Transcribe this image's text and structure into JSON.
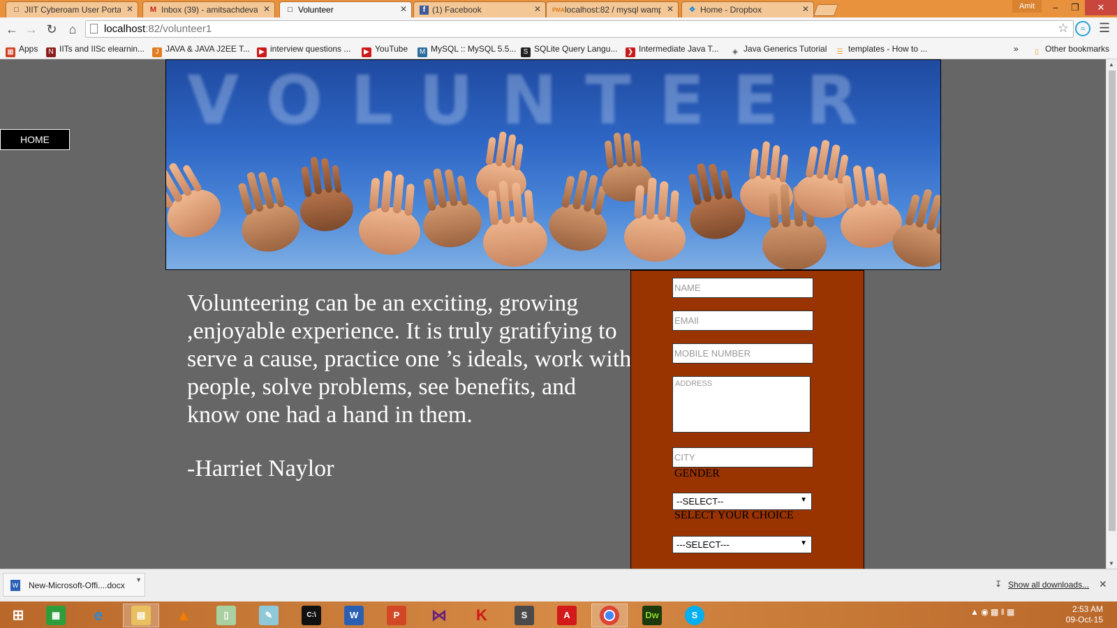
{
  "tabs": [
    {
      "title": "JIIT Cyberoam User Portal",
      "icon": "page-icon"
    },
    {
      "title": "Inbox (39) - amitsachdeva",
      "icon": "gmail-icon"
    },
    {
      "title": "Volunteer",
      "icon": "page-icon"
    },
    {
      "title": "(1) Facebook",
      "icon": "facebook-icon"
    },
    {
      "title": "localhost:82 / mysql wamp",
      "icon": "phpmyadmin-icon"
    },
    {
      "title": "Home - Dropbox",
      "icon": "dropbox-icon"
    }
  ],
  "window": {
    "user": "Amit"
  },
  "address_bar": {
    "host": "localhost",
    "path": ":82/volunteer1"
  },
  "bookmarks": [
    {
      "label": "Apps",
      "icon": "apps-grid-icon",
      "color": "#d04020"
    },
    {
      "label": "IITs and IISc elearnin...",
      "icon": "nptel-icon",
      "color": "#8a1f1f"
    },
    {
      "label": "JAVA & JAVA J2EE T...",
      "icon": "java-icon",
      "color": "#e07b20"
    },
    {
      "label": "interview questions ...",
      "icon": "youtube-icon",
      "color": "#cc1b1b"
    },
    {
      "label": "YouTube",
      "icon": "youtube-icon",
      "color": "#cc1b1b"
    },
    {
      "label": "MySQL :: MySQL 5.5...",
      "icon": "mysql-icon",
      "color": "#2c6e9b"
    },
    {
      "label": "SQLite Query Langu...",
      "icon": "sqlite-icon",
      "color": "#222222"
    },
    {
      "label": "Intermediate Java T...",
      "icon": "arrow-icon",
      "color": "#c81c1c"
    },
    {
      "label": "Java Generics Tutorial",
      "icon": "diamond-icon",
      "color": "#555555"
    },
    {
      "label": "templates - How to ...",
      "icon": "stack-icon",
      "color": "#f0a030"
    }
  ],
  "bookmarks_overflow": "»",
  "other_bookmarks": "Other bookmarks",
  "page": {
    "home_button": "HOME",
    "banner_word": "VOLUNTEER",
    "quote": "Volunteering can be an exciting, growing ,enjoyable experience. It is truly gratifying to serve a cause, practice one ’s ideals, work with people, solve problems, see benefits, and know one had a hand in them.",
    "author": "-Harriet Naylor"
  },
  "form": {
    "name_placeholder": "NAME",
    "email_placeholder": "EMAIl",
    "mobile_placeholder": "MOBILE NUMBER",
    "address_placeholder": "ADDRESS",
    "city_placeholder": "CITY",
    "gender_label": "GENDER",
    "gender_select": "--SELECT--",
    "choice_label": "SELECT YOUR CHOICE",
    "choice_select": "---SELECT---"
  },
  "downloads": {
    "file_name": "New-Microsoft-Offi....docx",
    "show_all": "Show all downloads..."
  },
  "taskbar": {
    "apps": [
      "windows-start-icon",
      "store-icon",
      "internet-explorer-icon",
      "file-explorer-icon",
      "vlc-icon",
      "folder-icon",
      "notepad-icon",
      "cmd-icon",
      "word-icon",
      "powerpoint-icon",
      "visual-studio-icon",
      "kaspersky-icon",
      "sublime-icon",
      "acrobat-icon",
      "chrome-icon",
      "dreamweaver-icon",
      "skype-icon"
    ],
    "time": "2:53 AM",
    "date": "09-Oct-15"
  },
  "colors": {
    "page_bg": "#666666",
    "form_bg": "#993300",
    "tab_strip": "#e8923e"
  }
}
